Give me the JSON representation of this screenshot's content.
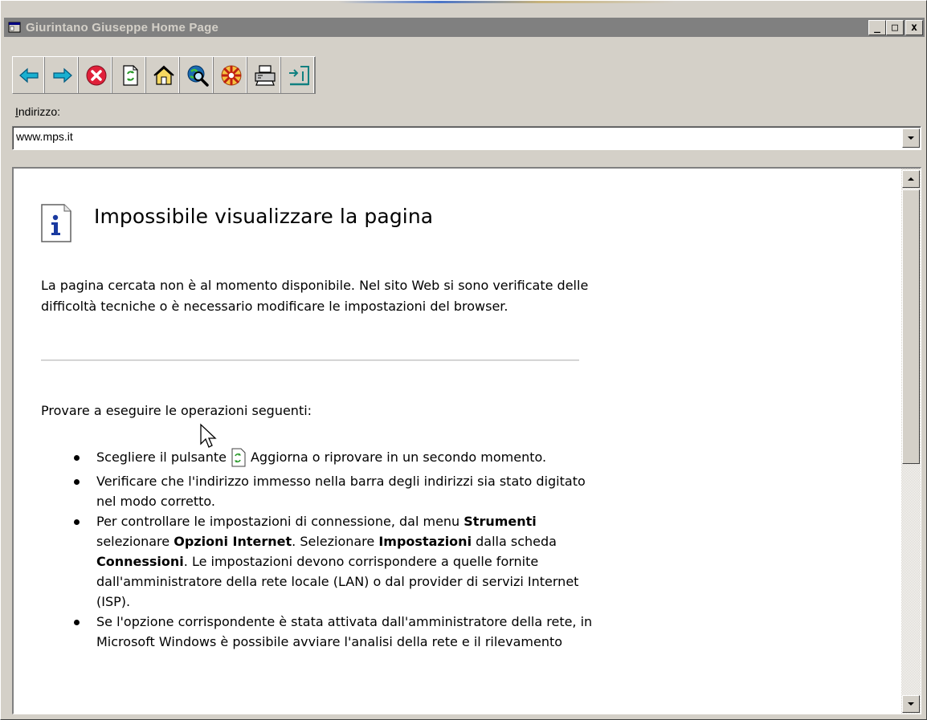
{
  "window": {
    "title": "Giurintano Giuseppe Home Page",
    "controls": {
      "minimize": "_",
      "maximize": "□",
      "close": "x"
    }
  },
  "toolbar": {
    "buttons": [
      {
        "name": "back",
        "icon": "back-arrow-icon",
        "color": "#00a0c0"
      },
      {
        "name": "forward",
        "icon": "forward-arrow-icon",
        "color": "#00a0c0"
      },
      {
        "name": "stop",
        "icon": "stop-icon",
        "color": "#e0203a"
      },
      {
        "name": "refresh",
        "icon": "refresh-icon",
        "color": "#3a9a3a"
      },
      {
        "name": "home",
        "icon": "home-icon",
        "color": "#e0a020"
      },
      {
        "name": "search",
        "icon": "search-globe-icon",
        "color": "#1a6ab0"
      },
      {
        "name": "favorites",
        "icon": "favorites-icon",
        "color": "#e05020"
      },
      {
        "name": "print",
        "icon": "printer-icon",
        "color": "#404040"
      },
      {
        "name": "exit",
        "icon": "exit-door-icon",
        "color": "#108080"
      }
    ]
  },
  "address": {
    "label_access_key": "I",
    "label_rest": "ndirizzo:",
    "value": "www.mps.it"
  },
  "page": {
    "title": "Impossibile visualizzare la pagina",
    "intro": "La pagina cercata non è al momento disponibile. Nel sito Web si sono verificate delle difficoltà tecniche o è necessario modificare le impostazioni del browser.",
    "try_heading": "Provare a eseguire le operazioni seguenti:",
    "steps": {
      "s1_before": "Scegliere il pulsante",
      "s1_after": "Aggiorna o riprovare in un secondo momento.",
      "s2": "Verificare che l'indirizzo immesso nella barra degli indirizzi sia stato digitato nel modo corretto.",
      "s3_a": "Per controllare le impostazioni di connessione, dal menu",
      "s3_b": "Strumenti",
      "s3_c": "selezionare",
      "s3_d": "Opzioni Internet",
      "s3_e": ". Selezionare",
      "s3_f": "Impostazioni",
      "s3_g": "dalla scheda",
      "s3_h": "Connessioni",
      "s3_i": ". Le impostazioni devono corrispondere a quelle fornite dall'amministratore della rete locale (LAN) o dal provider di servizi Internet (ISP).",
      "s4": "Se l'opzione corrispondente è stata attivata dall'amministratore della rete, in Microsoft Windows è possibile avviare l'analisi della rete e il rilevamento"
    }
  }
}
